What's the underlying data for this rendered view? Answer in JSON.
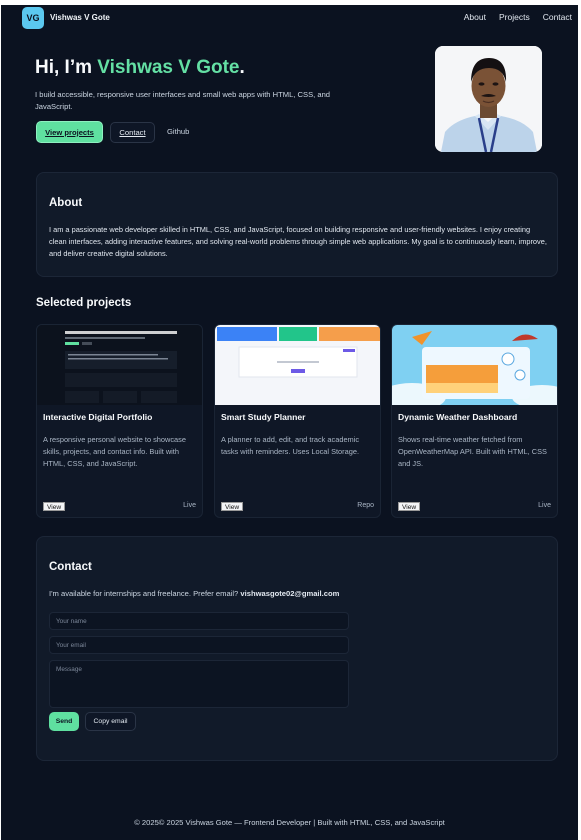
{
  "header": {
    "logo_text": "VG",
    "brand": "Vishwas V Gote",
    "nav": [
      "About",
      "Projects",
      "Contact"
    ]
  },
  "hero": {
    "greeting": "Hi, I’m ",
    "name": "Vishwas V Gote",
    "punct": ".",
    "subtitle": "I build accessible, responsive user interfaces and small web apps with HTML, CSS, and JavaScript.",
    "btn_projects": "View projects",
    "btn_contact": "Contact",
    "btn_github": "Github"
  },
  "about": {
    "title": "About",
    "text": "I am a passionate web developer skilled in HTML, CSS, and JavaScript, focused on building responsive and user-friendly websites. I enjoy creating clean interfaces, adding interactive features, and solving real-world problems through simple web applications. My goal is to continuously learn, improve, and deliver creative digital solutions."
  },
  "projects": {
    "title": "Selected projects",
    "items": [
      {
        "name": "Interactive Digital Portfolio",
        "desc": "A responsive personal website to showcase skills, projects, and contact info. Built with HTML, CSS, and JavaScript.",
        "view": "View",
        "link": "Live"
      },
      {
        "name": "Smart Study Planner",
        "desc": "A planner to add, edit, and track academic tasks with reminders. Uses Local Storage.",
        "view": "View",
        "link": "Repo"
      },
      {
        "name": "Dynamic Weather Dashboard",
        "desc": "Shows real-time weather fetched from OpenWeatherMap API. Built with HTML, CSS and JS.",
        "view": "View",
        "link": "Live"
      }
    ]
  },
  "contact": {
    "title": "Contact",
    "line": "I'm available for internships and freelance. Prefer email? ",
    "email": "vishwasgote02@gmail.com",
    "name_placeholder": "Your name",
    "email_placeholder": "Your email",
    "message_placeholder": "Message",
    "send": "Send",
    "copy": "Copy email"
  },
  "footer": {
    "text": "© 2025© 2025 Vishwas Gote — Frontend Developer | Built with HTML, CSS, and JavaScript"
  },
  "colors": {
    "background": "#0b1220",
    "card": "#111a29",
    "accent": "#64e0a4",
    "logo": "#5bc8ef"
  }
}
